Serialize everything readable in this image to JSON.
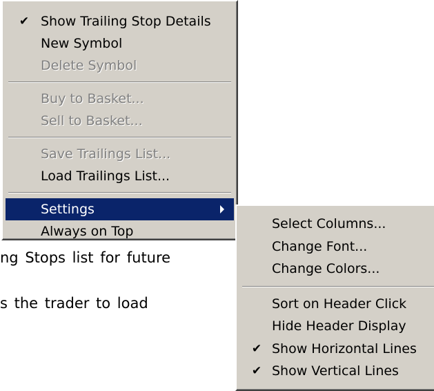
{
  "main_menu": {
    "items": [
      {
        "label": "Show Trailing Stop Details",
        "checked": true,
        "enabled": true
      },
      {
        "label": "New Symbol",
        "enabled": true
      },
      {
        "label": "Delete Symbol",
        "enabled": false
      },
      {
        "label": "Buy to Basket...",
        "enabled": false
      },
      {
        "label": "Sell to Basket...",
        "enabled": false
      },
      {
        "label": "Save Trailings List...",
        "enabled": false
      },
      {
        "label": "Load Trailings List...",
        "enabled": true
      },
      {
        "label": "Settings",
        "enabled": true,
        "highlighted": true,
        "has_submenu": true
      },
      {
        "label": "Always on Top",
        "enabled": true
      }
    ]
  },
  "settings_submenu": {
    "items": [
      {
        "label": "Select Columns...",
        "enabled": true
      },
      {
        "label": "Change Font...",
        "enabled": true
      },
      {
        "label": "Change Colors...",
        "enabled": true
      },
      {
        "label": "Sort on Header Click",
        "enabled": true
      },
      {
        "label": "Hide Header Display",
        "enabled": true
      },
      {
        "label": "Show Horizontal Lines",
        "checked": true,
        "enabled": true
      },
      {
        "label": "Show Vertical Lines",
        "checked": true,
        "enabled": true
      }
    ]
  },
  "background_text": {
    "line1": "ng Stops list for future",
    "line2": "s  the  trader  to  load"
  },
  "glyphs": {
    "check": "✔"
  },
  "colors": {
    "menu_bg": "#d4d0c8",
    "highlight": "#0a246a",
    "disabled_text": "#808080"
  }
}
